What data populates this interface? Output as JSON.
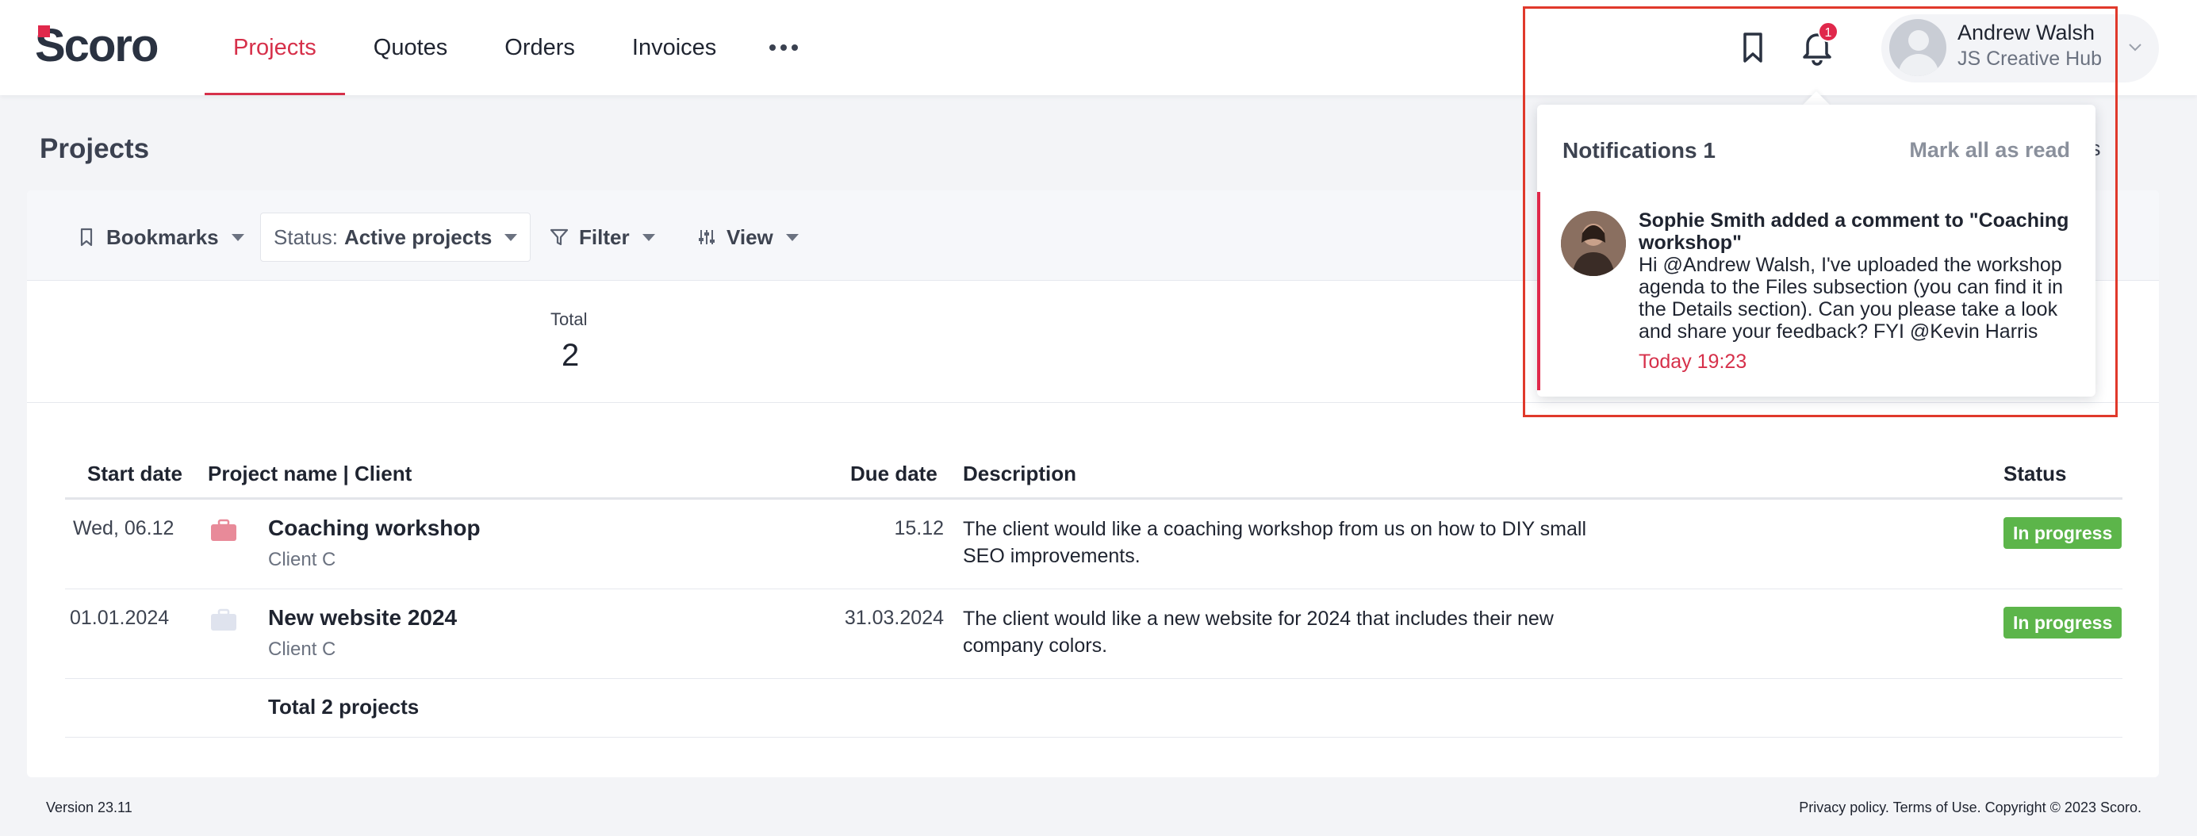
{
  "brand": {
    "logo_text": "Scoro",
    "accent": "#d6304a",
    "logo_red": "#e0284b"
  },
  "nav": {
    "items": [
      "Projects",
      "Quotes",
      "Orders",
      "Invoices"
    ],
    "active": "Projects",
    "more_icon": "more-dots-icon"
  },
  "header_icons": {
    "bookmark": "bookmark-icon",
    "bell": "bell-icon",
    "notification_count": "1"
  },
  "user": {
    "name": "Andrew Walsh",
    "company": "JS Creative Hub",
    "chevron": "chevron-down-icon"
  },
  "page": {
    "title": "Projects",
    "settings_partial": "gs"
  },
  "toolbar": {
    "bookmarks_label": "Bookmarks",
    "status_prefix": "Status:",
    "status_value": "Active projects",
    "filter_label": "Filter",
    "view_label": "View"
  },
  "totals": {
    "label": "Total",
    "value": "2"
  },
  "table": {
    "columns": [
      "Start date",
      "Project name | Client",
      "Due date",
      "Description",
      "Status"
    ],
    "rows": [
      {
        "start": "Wed, 06.12",
        "name": "Coaching workshop",
        "client": "Client C",
        "due": "15.12",
        "description": "The client would like a coaching workshop from us on how to DIY small SEO improvements.",
        "status": "In progress",
        "icon_color": "#e88a99"
      },
      {
        "start": "01.01.2024",
        "name": "New website 2024",
        "client": "Client C",
        "due": "31.03.2024",
        "description": "The client would like a new website for 2024 that includes their new company colors.",
        "status": "In progress",
        "icon_color": "#dfe3ee"
      }
    ],
    "total_text": "Total 2 projects",
    "status_color": "#5cb54a"
  },
  "notifications": {
    "header": "Notifications 1",
    "mark_all": "Mark all as read",
    "items": [
      {
        "title": "Sophie Smith added a comment to \"Coaching workshop\"",
        "body": "Hi @Andrew Walsh, I've uploaded the workshop agenda to the Files subsection (you can find it in the Details section). Can you please take a look and share your feedback? FYI @Kevin Harris",
        "time": "Today 19:23"
      }
    ],
    "highlight_color": "#e0392b"
  },
  "footer": {
    "version": "Version 23.11",
    "legal": "Privacy policy. Terms of Use. Copyright © 2023 Scoro."
  }
}
